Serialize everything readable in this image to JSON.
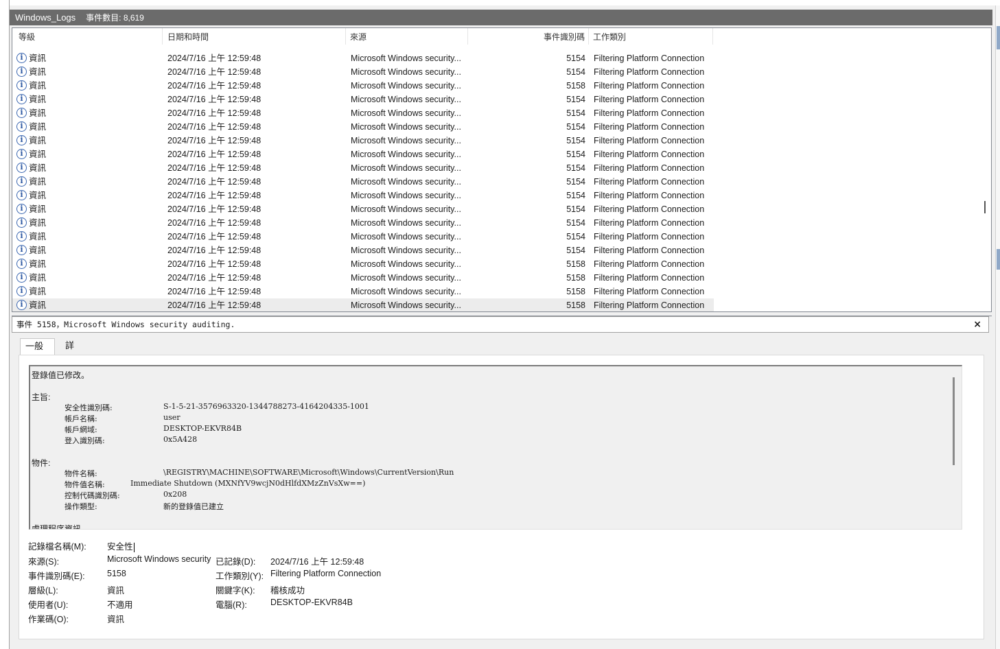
{
  "title_bar": {
    "log_name": "Windows_Logs",
    "event_count": "事件數目: 8,619"
  },
  "columns": {
    "level": "等級",
    "datetime": "日期和時間",
    "source": "來源",
    "event_id": "事件識別碼",
    "task_category": "工作類別"
  },
  "partial_top_row": {
    "level": "資訊",
    "datetime": "2024/7/16 上午 12:59:48",
    "source": "Microsoft Windows security...",
    "event_id": "5154",
    "task": "Filtering Platform Connection"
  },
  "rows": [
    {
      "level": "資訊",
      "datetime": "2024/7/16 上午 12:59:48",
      "source": "Microsoft Windows security...",
      "event_id": "5154",
      "task": "Filtering Platform Connection"
    },
    {
      "level": "資訊",
      "datetime": "2024/7/16 上午 12:59:48",
      "source": "Microsoft Windows security...",
      "event_id": "5154",
      "task": "Filtering Platform Connection"
    },
    {
      "level": "資訊",
      "datetime": "2024/7/16 上午 12:59:48",
      "source": "Microsoft Windows security...",
      "event_id": "5158",
      "task": "Filtering Platform Connection"
    },
    {
      "level": "資訊",
      "datetime": "2024/7/16 上午 12:59:48",
      "source": "Microsoft Windows security...",
      "event_id": "5154",
      "task": "Filtering Platform Connection"
    },
    {
      "level": "資訊",
      "datetime": "2024/7/16 上午 12:59:48",
      "source": "Microsoft Windows security...",
      "event_id": "5154",
      "task": "Filtering Platform Connection"
    },
    {
      "level": "資訊",
      "datetime": "2024/7/16 上午 12:59:48",
      "source": "Microsoft Windows security...",
      "event_id": "5154",
      "task": "Filtering Platform Connection"
    },
    {
      "level": "資訊",
      "datetime": "2024/7/16 上午 12:59:48",
      "source": "Microsoft Windows security...",
      "event_id": "5154",
      "task": "Filtering Platform Connection"
    },
    {
      "level": "資訊",
      "datetime": "2024/7/16 上午 12:59:48",
      "source": "Microsoft Windows security...",
      "event_id": "5154",
      "task": "Filtering Platform Connection"
    },
    {
      "level": "資訊",
      "datetime": "2024/7/16 上午 12:59:48",
      "source": "Microsoft Windows security...",
      "event_id": "5154",
      "task": "Filtering Platform Connection"
    },
    {
      "level": "資訊",
      "datetime": "2024/7/16 上午 12:59:48",
      "source": "Microsoft Windows security...",
      "event_id": "5154",
      "task": "Filtering Platform Connection"
    },
    {
      "level": "資訊",
      "datetime": "2024/7/16 上午 12:59:48",
      "source": "Microsoft Windows security...",
      "event_id": "5154",
      "task": "Filtering Platform Connection"
    },
    {
      "level": "資訊",
      "datetime": "2024/7/16 上午 12:59:48",
      "source": "Microsoft Windows security...",
      "event_id": "5154",
      "task": "Filtering Platform Connection"
    },
    {
      "level": "資訊",
      "datetime": "2024/7/16 上午 12:59:48",
      "source": "Microsoft Windows security...",
      "event_id": "5154",
      "task": "Filtering Platform Connection"
    },
    {
      "level": "資訊",
      "datetime": "2024/7/16 上午 12:59:48",
      "source": "Microsoft Windows security...",
      "event_id": "5154",
      "task": "Filtering Platform Connection"
    },
    {
      "level": "資訊",
      "datetime": "2024/7/16 上午 12:59:48",
      "source": "Microsoft Windows security...",
      "event_id": "5154",
      "task": "Filtering Platform Connection"
    },
    {
      "level": "資訊",
      "datetime": "2024/7/16 上午 12:59:48",
      "source": "Microsoft Windows security...",
      "event_id": "5158",
      "task": "Filtering Platform Connection"
    },
    {
      "level": "資訊",
      "datetime": "2024/7/16 上午 12:59:48",
      "source": "Microsoft Windows security...",
      "event_id": "5158",
      "task": "Filtering Platform Connection"
    },
    {
      "level": "資訊",
      "datetime": "2024/7/16 上午 12:59:48",
      "source": "Microsoft Windows security...",
      "event_id": "5158",
      "task": "Filtering Platform Connection"
    },
    {
      "level": "資訊",
      "datetime": "2024/7/16 上午 12:59:48",
      "source": "Microsoft Windows security...",
      "event_id": "5158",
      "task": "Filtering Platform Connection"
    }
  ],
  "detail": {
    "header": "事件 5158，Microsoft Windows security auditing.",
    "close": "×",
    "tabs": {
      "general": "一般",
      "details": "詳細資料"
    },
    "description": {
      "line1": "登錄值已修改。",
      "subject_heading": "主旨:",
      "sid_label": "安全性識別碼:",
      "sid_value": "S-1-5-21-3576963320-1344788273-4164204335-1001",
      "account_label": "帳戶名稱:",
      "account_value": "user",
      "domain_label": "帳戶網域:",
      "domain_value": "DESKTOP-EKVR84B",
      "logon_label": "登入識別碼:",
      "logon_value": "0x5A428",
      "object_heading": "物件:",
      "objname_label": "物件名稱:",
      "objname_value": "\\REGISTRY\\MACHINE\\SOFTWARE\\Microsoft\\Windows\\CurrentVersion\\Run",
      "valname_label": "物件值名稱:",
      "valname_value": "Immediate Shutdown (MXNfYV9wcjN0dHlfdXMzZnVsXw==)",
      "handle_label": "控制代碼識別碼:",
      "handle_value": "0x208",
      "optype_label": "操作類型:",
      "optype_value": "新的登錄值已建立",
      "process_heading": "處理程序資訊"
    },
    "props": {
      "logname_label": "記錄檔名稱(M):",
      "logname_value": "安全性",
      "source_label": "來源(S):",
      "source_value": "Microsoft Windows security",
      "logged_label": "已記錄(D):",
      "logged_value": "2024/7/16 上午 12:59:48",
      "eventid_label": "事件識別碼(E):",
      "eventid_value": "5158",
      "task_label": "工作類別(Y):",
      "task_value": "Filtering Platform Connection",
      "level_label": "層級(L):",
      "level_value": "資訊",
      "keywords_label": "關鍵字(K):",
      "keywords_value": "稽核成功",
      "user_label": "使用者(U):",
      "user_value": "不適用",
      "computer_label": "電腦(R):",
      "computer_value": "DESKTOP-EKVR84B",
      "opcode_label": "作業碼(O):",
      "opcode_value": "資訊"
    }
  }
}
